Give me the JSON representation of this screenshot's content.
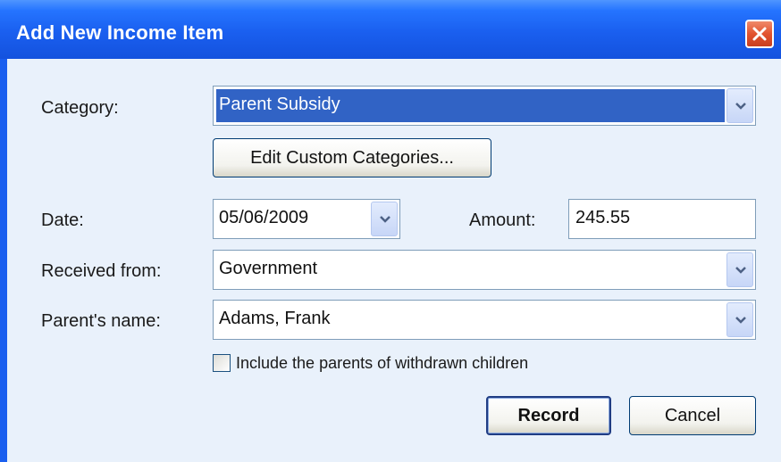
{
  "window": {
    "title": "Add New Income Item"
  },
  "form": {
    "category_label": "Category:",
    "category_value": "Parent Subsidy",
    "edit_categories_label": "Edit Custom Categories...",
    "date_label": "Date:",
    "date_value": "05/06/2009",
    "amount_label": "Amount:",
    "amount_value": "245.55",
    "received_from_label": "Received from:",
    "received_from_value": "Government",
    "parent_name_label": "Parent's name:",
    "parent_name_value": "Adams, Frank",
    "include_withdrawn_label": "Include the parents of withdrawn children",
    "include_withdrawn_checked": false
  },
  "buttons": {
    "record": "Record",
    "cancel": "Cancel"
  },
  "icons": {
    "close": "close-icon",
    "dropdown": "chevron-down-icon"
  },
  "colors": {
    "titlebar": "#1a5fef",
    "dialog_background": "#e9f1fb",
    "selection": "#3163c5",
    "close_button": "#e2532f"
  }
}
